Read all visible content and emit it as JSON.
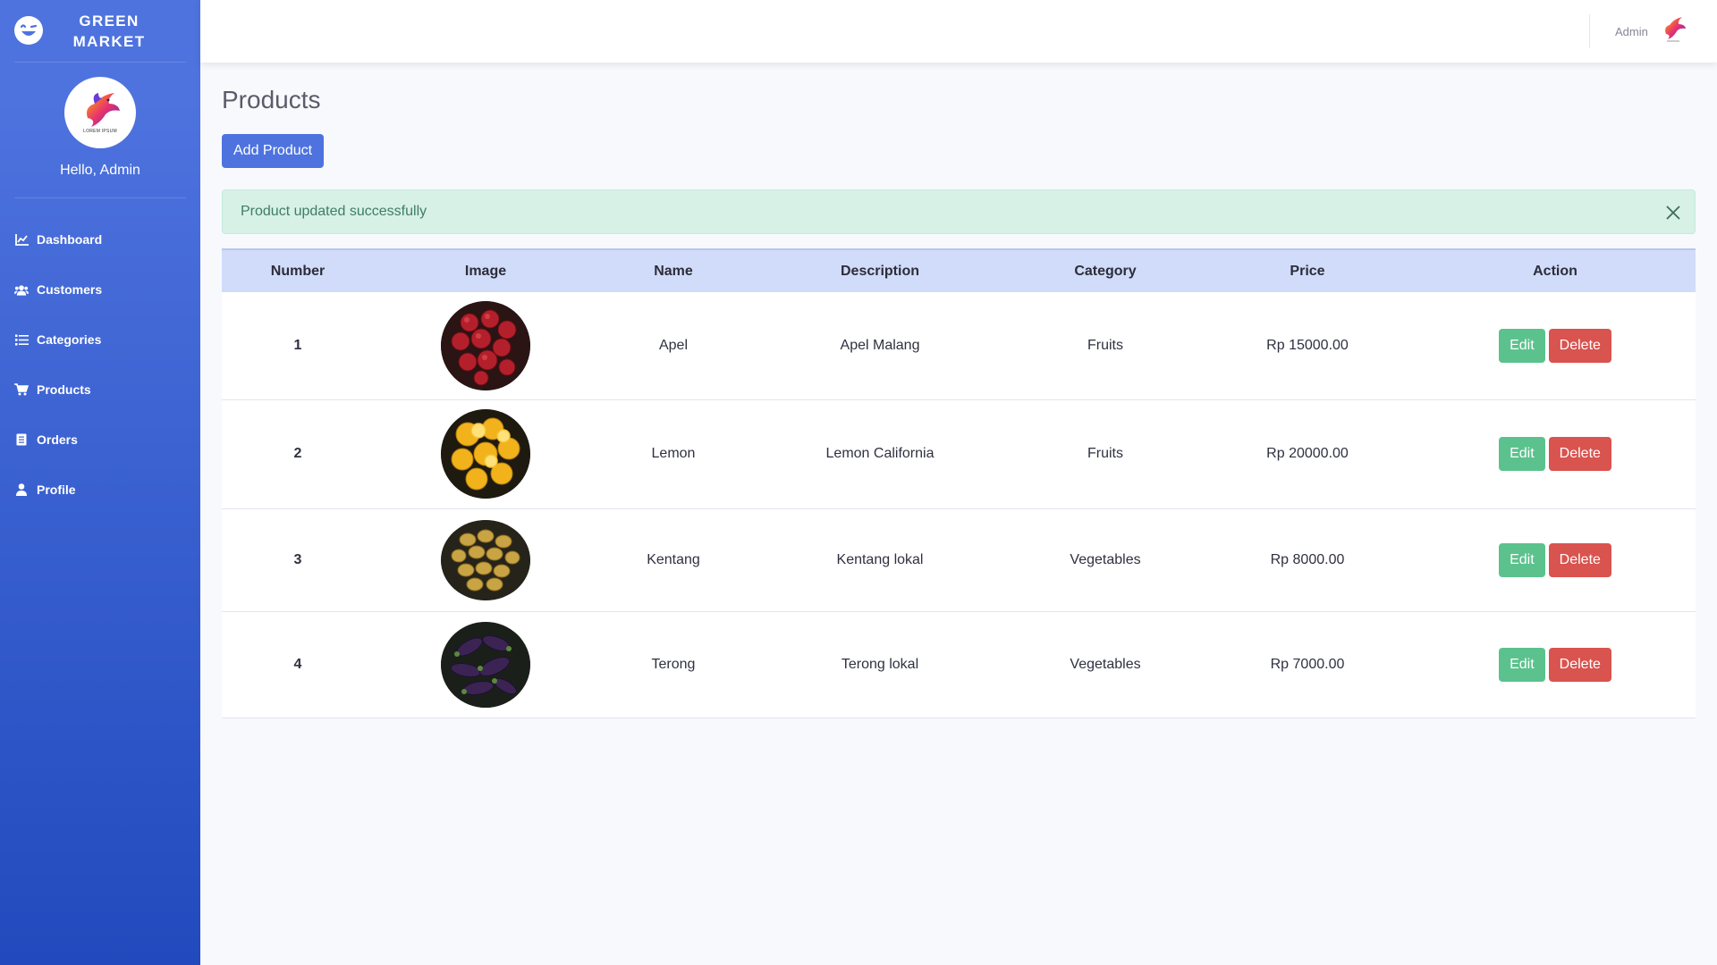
{
  "brand": {
    "name_line1": "GREEN",
    "name_line2": "MARKET"
  },
  "sidebar": {
    "greeting": "Hello, Admin",
    "avatar_caption": "LOREM IPSUM",
    "items": [
      {
        "label": "Dashboard",
        "icon": "chart-line-icon"
      },
      {
        "label": "Customers",
        "icon": "users-icon"
      },
      {
        "label": "Categories",
        "icon": "list-icon"
      },
      {
        "label": "Products",
        "icon": "cart-icon"
      },
      {
        "label": "Orders",
        "icon": "receipt-icon"
      },
      {
        "label": "Profile",
        "icon": "user-icon"
      }
    ]
  },
  "topbar": {
    "user_name": "Admin"
  },
  "main": {
    "title": "Products",
    "add_button": "Add Product",
    "alert": "Product updated successfully",
    "table": {
      "headers": [
        "Number",
        "Image",
        "Name",
        "Description",
        "Category",
        "Price",
        "Action"
      ],
      "rows": [
        {
          "number": "1",
          "image": "red-apples",
          "name": "Apel",
          "description": "Apel Malang",
          "category": "Fruits",
          "price": "Rp 15000.00"
        },
        {
          "number": "2",
          "image": "lemons",
          "name": "Lemon",
          "description": "Lemon California",
          "category": "Fruits",
          "price": "Rp 20000.00"
        },
        {
          "number": "3",
          "image": "potatoes",
          "name": "Kentang",
          "description": "Kentang lokal",
          "category": "Vegetables",
          "price": "Rp 8000.00"
        },
        {
          "number": "4",
          "image": "eggplants",
          "name": "Terong",
          "description": "Terong lokal",
          "category": "Vegetables",
          "price": "Rp 7000.00"
        }
      ],
      "edit_label": "Edit",
      "delete_label": "Delete"
    }
  },
  "colors": {
    "sidebar_start": "#4e73df",
    "sidebar_end": "#224abe",
    "primary": "#4e73df",
    "edit": "#5bc28d",
    "delete": "#d9534f",
    "alert_bg": "#d7f1e7",
    "table_header_bg": "#d1dcfa"
  }
}
